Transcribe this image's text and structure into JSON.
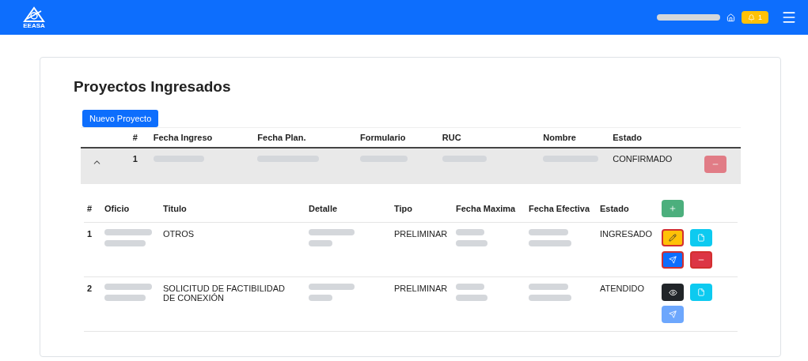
{
  "navbar": {
    "logo_text": "EEASA",
    "notifications": "1"
  },
  "title": "Proyectos Ingresados",
  "new_button": "Nuevo Proyecto",
  "columns": [
    {
      "kind": "expand"
    },
    {
      "label": "#",
      "kind": "text"
    },
    {
      "label": "Fecha Ingreso",
      "kind": "blurred"
    },
    {
      "label": "Fecha Plan.",
      "kind": "blurred"
    },
    {
      "label": "Formulario",
      "kind": "blurred"
    },
    {
      "label": "RUC",
      "kind": "blurred"
    },
    {
      "label": "Nombre",
      "kind": "blurred"
    },
    {
      "label": "Estado",
      "kind": "text"
    },
    {
      "kind": "action"
    }
  ],
  "projects": [
    {
      "expanded": true,
      "cells": [
        "",
        "1",
        "",
        "",
        "",
        "",
        "",
        "CONFIRMADO",
        ""
      ],
      "delete_disabled": true,
      "sub_columns": [
        {
          "label": "#",
          "kind": "text"
        },
        {
          "label": "Oficio",
          "kind": "blurred"
        },
        {
          "label": "Titulo",
          "kind": "text"
        },
        {
          "label": "Detalle",
          "kind": "blurred"
        },
        {
          "label": "Tipo",
          "kind": "text"
        },
        {
          "label": "Fecha Maxima",
          "kind": "blurred"
        },
        {
          "label": "Fecha Efectiva",
          "kind": "blurred"
        },
        {
          "label": "Estado",
          "kind": "text"
        }
      ],
      "oficios": [
        {
          "cells": [
            "1",
            "",
            "OTROS",
            "",
            "PRELIMINAR",
            "",
            "",
            "INGRESADO"
          ],
          "actions": [
            {
              "kind": "edit",
              "highlighted": true,
              "disabled": false
            },
            {
              "kind": "file",
              "highlighted": false,
              "disabled": false
            },
            {
              "kind": "send",
              "highlighted": true,
              "disabled": false
            },
            {
              "kind": "delete",
              "highlighted": true,
              "disabled": false
            }
          ]
        },
        {
          "cells": [
            "2",
            "",
            "SOLICITUD DE FACTIBILIDAD DE CONEXIÓN",
            "",
            "PRELIMINAR",
            "",
            "",
            "ATENDIDO"
          ],
          "actions": [
            {
              "kind": "view",
              "highlighted": false,
              "disabled": false
            },
            {
              "kind": "file",
              "highlighted": false,
              "disabled": false
            },
            {
              "kind": "send",
              "highlighted": false,
              "disabled": true
            }
          ]
        }
      ]
    }
  ]
}
